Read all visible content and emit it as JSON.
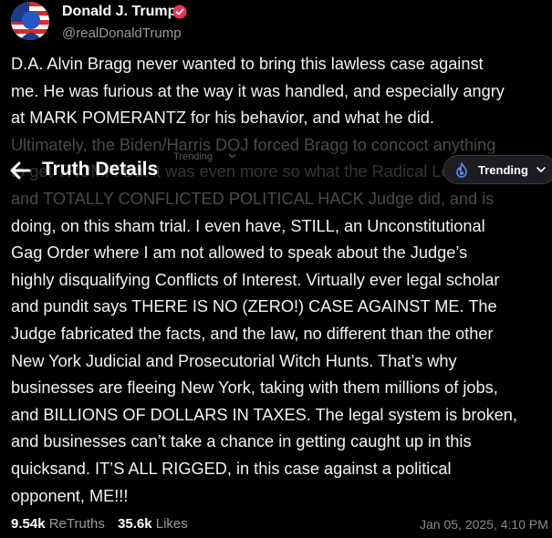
{
  "author": {
    "name": "Donald J. Trump",
    "handle": "@realDonaldTrump"
  },
  "post": {
    "lines": [
      "D.A. Alvin Bragg never wanted to bring this lawless case against",
      "me. He was furious at the way it was handled, and especially angry",
      "at MARK POMERANTZ  for his behavior, and what he did.",
      "Ultimately, the Biden/Harris DOJ forced Bragg to concoct anything",
      "to get TRUMP. But it was even more so what the Radical Left",
      "and TOTALLY CONFLICTED POLITICAL HACK Judge did, and is",
      "doing, on this sham trial. I even have, STILL, an Unconstitutional",
      "Gag Order where I am not allowed to speak about the Judge’s",
      "highly disqualifying Conflicts of Interest. Virtually ever legal scholar",
      "and pundit says THERE IS NO (ZERO!) CASE AGAINST ME. The",
      "Judge fabricated the facts, and the law, no different than the other",
      "New York Judicial and Prosecutorial Witch Hunts. That’s why",
      "businesses are fleeing New York, taking with them millions of jobs,",
      "and BILLIONS OF DOLLARS IN TAXES. The legal system is broken,",
      "and businesses can’t take a chance in getting caught up in this",
      "quicksand. IT’S ALL RIGGED, in this case against a political",
      "opponent, ME!!!"
    ]
  },
  "header": {
    "title": "Truth Details",
    "ghost_trending": "Trending",
    "trending_label": "Trending"
  },
  "stats": {
    "retruths_count": "9.54k",
    "retruths_label": "ReTruths",
    "likes_count": "35.6k",
    "likes_label": "Likes"
  },
  "timestamp": "Jan 05, 2025, 4:10 PM",
  "colors": {
    "verified": "#e8345a",
    "flame": "#5b8cff",
    "background": "#000000"
  },
  "icons": {
    "back": "arrow-left-icon",
    "verified": "verified-badge-icon",
    "trending": "flame-icon",
    "dropdown": "chevron-down-icon"
  }
}
